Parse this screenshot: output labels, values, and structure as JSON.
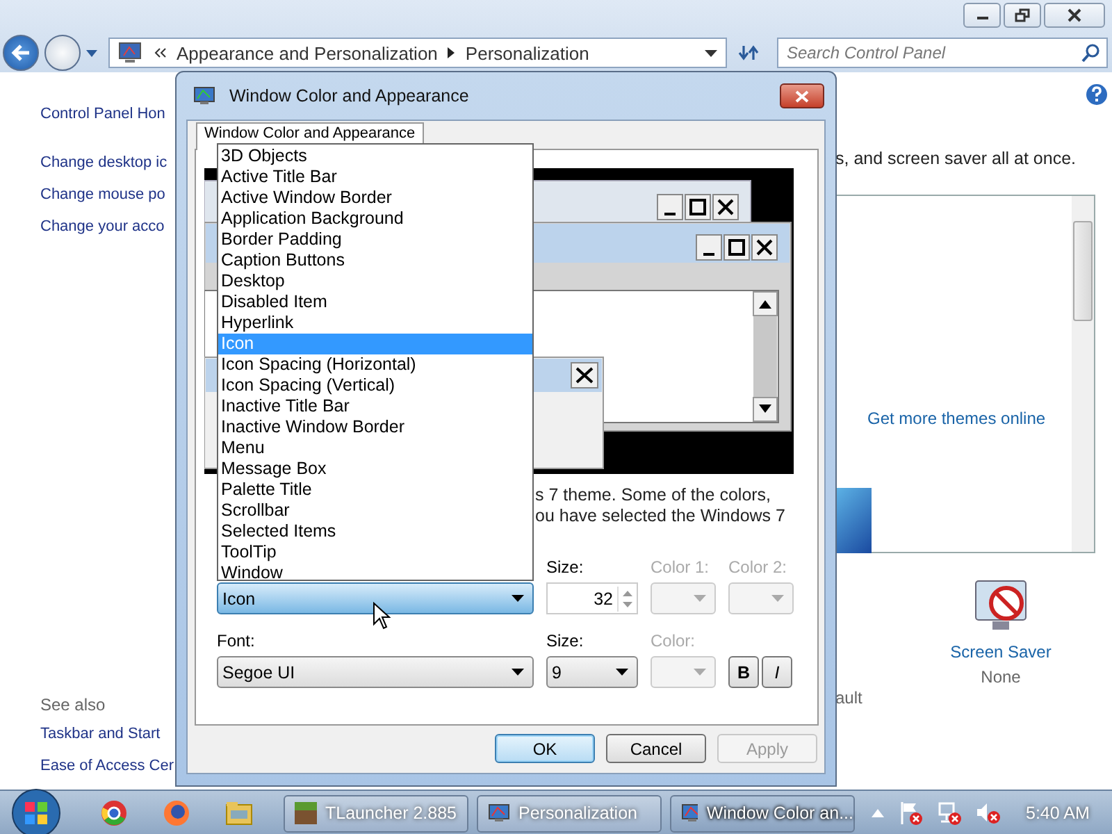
{
  "control_panel": {
    "breadcrumb": [
      "Appearance and Personalization",
      "Personalization"
    ],
    "search": {
      "placeholder": "Search Control Panel"
    },
    "sidebar": {
      "home_link": "Control Panel Hon",
      "tasks": [
        "Change desktop ic",
        "Change mouse po",
        "Change your acco"
      ],
      "see_also_heading": "See also",
      "see_also": [
        "Taskbar and Start",
        "Ease of Access Cer"
      ]
    },
    "content": {
      "intro": "s, and screen saver all at once.",
      "themes_link": "Get more themes online",
      "partial_label": "ault",
      "screen_saver": {
        "label": "Screen Saver",
        "value": "None"
      }
    }
  },
  "dialog": {
    "title": "Window Color and Appearance",
    "tab": {
      "label": "Window Color and Appearance",
      "selected": true
    },
    "description_lines": [
      "s 7 theme.  Some of the colors,",
      "ou have selected the Windows 7"
    ],
    "item_options": [
      {
        "label": "3D Objects",
        "selected": false
      },
      {
        "label": "Active Title Bar",
        "selected": false
      },
      {
        "label": "Active Window Border",
        "selected": false
      },
      {
        "label": "Application Background",
        "selected": false
      },
      {
        "label": "Border Padding",
        "selected": false
      },
      {
        "label": "Caption Buttons",
        "selected": false
      },
      {
        "label": "Desktop",
        "selected": false
      },
      {
        "label": "Disabled Item",
        "selected": false
      },
      {
        "label": "Hyperlink",
        "selected": false
      },
      {
        "label": "Icon",
        "selected": true
      },
      {
        "label": "Icon Spacing (Horizontal)",
        "selected": false
      },
      {
        "label": "Icon Spacing (Vertical)",
        "selected": false
      },
      {
        "label": "Inactive Title Bar",
        "selected": false
      },
      {
        "label": "Inactive Window Border",
        "selected": false
      },
      {
        "label": "Menu",
        "selected": false
      },
      {
        "label": "Message Box",
        "selected": false
      },
      {
        "label": "Palette Title",
        "selected": false
      },
      {
        "label": "Scrollbar",
        "selected": false
      },
      {
        "label": "Selected Items",
        "selected": false
      },
      {
        "label": "ToolTip",
        "selected": false
      },
      {
        "label": "Window",
        "selected": false
      }
    ],
    "item": {
      "value": "Icon"
    },
    "item_size": {
      "label": "Size:",
      "value": "32"
    },
    "color1": {
      "label": "Color 1:",
      "disabled": true
    },
    "color2": {
      "label": "Color 2:",
      "disabled": true
    },
    "font": {
      "label": "Font:",
      "value": "Segoe UI"
    },
    "font_size": {
      "label": "Size:",
      "value": "9"
    },
    "font_color": {
      "label": "Color:",
      "disabled": true
    },
    "style_buttons": [
      {
        "label": "B",
        "kind": "bold"
      },
      {
        "label": "I",
        "kind": "italic"
      }
    ],
    "buttons": [
      {
        "label": "OK",
        "default": true,
        "disabled": false
      },
      {
        "label": "Cancel",
        "default": false,
        "disabled": false
      },
      {
        "label": "Apply",
        "default": false,
        "disabled": true
      }
    ]
  },
  "taskbar": {
    "tasks": [
      {
        "label": "TLauncher 2.885",
        "active": false
      },
      {
        "label": "Personalization",
        "active": false
      },
      {
        "label": "Window Color an...",
        "active": true
      }
    ],
    "clock": "5:40 AM"
  }
}
